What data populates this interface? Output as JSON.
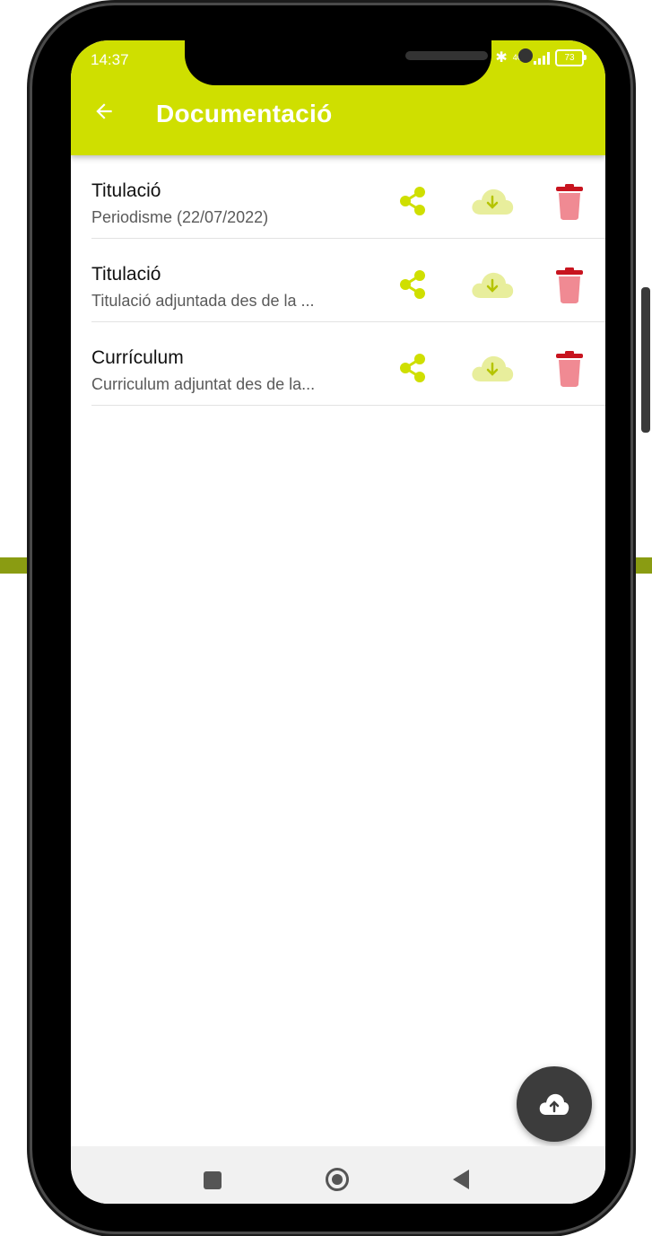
{
  "status_bar": {
    "time": "14:37",
    "network_label": "4G+",
    "battery_level": "73"
  },
  "header": {
    "back_icon": "arrow-left-icon",
    "title": "Documentació"
  },
  "documents": [
    {
      "title": "Titulació",
      "subtitle": "Periodisme (22/07/2022)"
    },
    {
      "title": "Titulació",
      "subtitle": "Titulació adjuntada des de la ..."
    },
    {
      "title": "Currículum",
      "subtitle": "Curriculum adjuntat des de la..."
    }
  ],
  "row_actions": {
    "share_icon": "share-icon",
    "download_icon": "cloud-download-icon",
    "delete_icon": "trash-icon"
  },
  "fab": {
    "icon": "cloud-upload-icon"
  },
  "nav_bar": {
    "recent_icon": "square-icon",
    "home_icon": "circle-icon",
    "back_icon": "triangle-back-icon"
  },
  "colors": {
    "accent": "#cfdf00",
    "download_fill": "#e8ee9c",
    "delete": "#f08a93",
    "delete_lid": "#c8141f",
    "fab": "#3c3c3c",
    "background_band": "#8a9c12"
  }
}
